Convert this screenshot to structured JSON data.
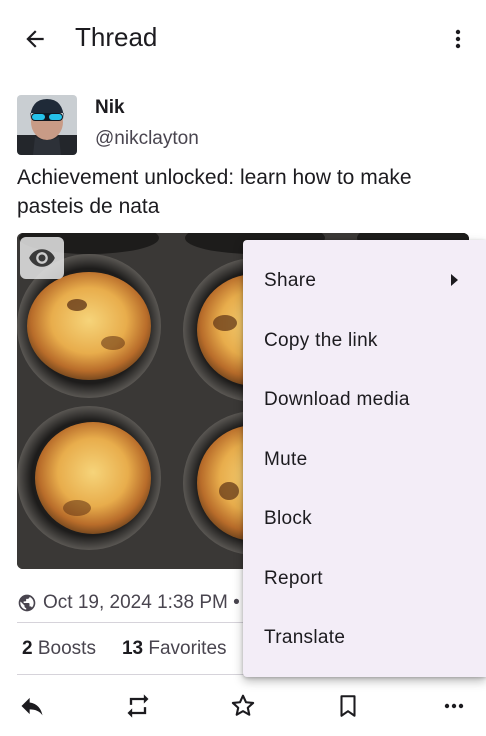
{
  "app_bar": {
    "title": "Thread",
    "back_icon": "arrow-back-icon",
    "overflow_icon": "more-vert-icon"
  },
  "status": {
    "display_name": "Nik",
    "username": "@nikclayton",
    "text": "Achievement unlocked: learn how to make pasteis de nata",
    "media_description": "tray of pasteis de nata",
    "visibility_icon": "globe-icon",
    "timestamp": "Oct 19, 2024 1:38 PM •",
    "boosts_count": "2",
    "boosts_label": "Boosts",
    "favorites_count": "13",
    "favorites_label": "Favorites"
  },
  "actions": [
    {
      "name": "reply-icon"
    },
    {
      "name": "boost-icon"
    },
    {
      "name": "favorite-icon"
    },
    {
      "name": "bookmark-icon"
    },
    {
      "name": "more-horiz-icon"
    }
  ],
  "menu": {
    "items": [
      {
        "label": "Share",
        "has_submenu": true
      },
      {
        "label": "Copy the link"
      },
      {
        "label": "Download media"
      },
      {
        "label": "Mute"
      },
      {
        "label": "Block"
      },
      {
        "label": "Report"
      },
      {
        "label": "Translate"
      }
    ]
  },
  "colors": {
    "menu_background": "#f3edf7",
    "text_primary": "#1c1b1f",
    "text_secondary": "#49454f"
  }
}
